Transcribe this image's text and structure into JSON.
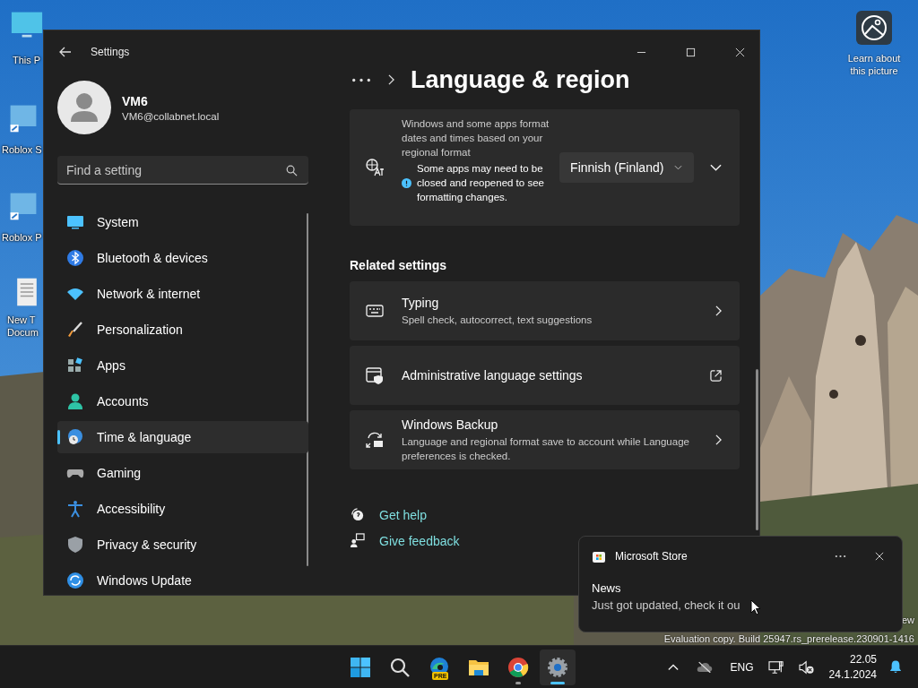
{
  "desktop": {
    "icons": [
      {
        "lines": [
          "This P"
        ]
      },
      {
        "lines": [
          "Roblox S"
        ]
      },
      {
        "lines": [
          "Roblox P"
        ]
      },
      {
        "lines": [
          "New T",
          "Docum"
        ]
      }
    ],
    "spotlight": {
      "lines": [
        "Learn about",
        "this picture"
      ]
    },
    "watermark": [
      "ew",
      "Evaluation copy. Build 25947.rs_prerelease.230901-1416"
    ]
  },
  "window": {
    "title": "Settings",
    "user": {
      "name": "VM6",
      "email": "VM6@collabnet.local"
    },
    "search": {
      "placeholder": "Find a setting"
    },
    "nav": [
      {
        "label": "System",
        "selected": false
      },
      {
        "label": "Bluetooth & devices",
        "selected": false
      },
      {
        "label": "Network & internet",
        "selected": false
      },
      {
        "label": "Personalization",
        "selected": false
      },
      {
        "label": "Apps",
        "selected": false
      },
      {
        "label": "Accounts",
        "selected": false
      },
      {
        "label": "Time & language",
        "selected": true
      },
      {
        "label": "Gaming",
        "selected": false
      },
      {
        "label": "Accessibility",
        "selected": false
      },
      {
        "label": "Privacy & security",
        "selected": false
      },
      {
        "label": "Windows Update",
        "selected": false
      }
    ],
    "page_title": "Language & region",
    "format_card": {
      "description": "Windows and some apps format dates and times based on your regional format",
      "note": "Some apps may need to be closed and reopened to see formatting changes.",
      "value": "Finnish (Finland)",
      "expanded": false
    },
    "related_heading": "Related settings",
    "related": [
      {
        "kind": "chevron",
        "title": "Typing",
        "subtitle": "Spell check, autocorrect, text suggestions"
      },
      {
        "kind": "external",
        "title": "Administrative language settings"
      },
      {
        "kind": "chevron",
        "title": "Windows Backup",
        "subtitle": "Language and regional format save to account while Language preferences is checked."
      }
    ],
    "help_links": [
      "Get help",
      "Give feedback"
    ]
  },
  "toast": {
    "app": "Microsoft Store",
    "title": "News",
    "body": "Just got updated, check it ou"
  },
  "taskbar": {
    "apps": [
      {
        "kind": "start",
        "selected": false,
        "running": false
      },
      {
        "kind": "search",
        "selected": false,
        "running": false
      },
      {
        "kind": "edge",
        "badge": "PRE",
        "selected": false,
        "running": false
      },
      {
        "kind": "explorer",
        "selected": false,
        "running": false
      },
      {
        "kind": "chrome",
        "selected": false,
        "running": true
      },
      {
        "kind": "settings",
        "selected": true,
        "running": true
      }
    ],
    "language": "ENG",
    "time": "22.05",
    "date": "24.1.2024"
  }
}
